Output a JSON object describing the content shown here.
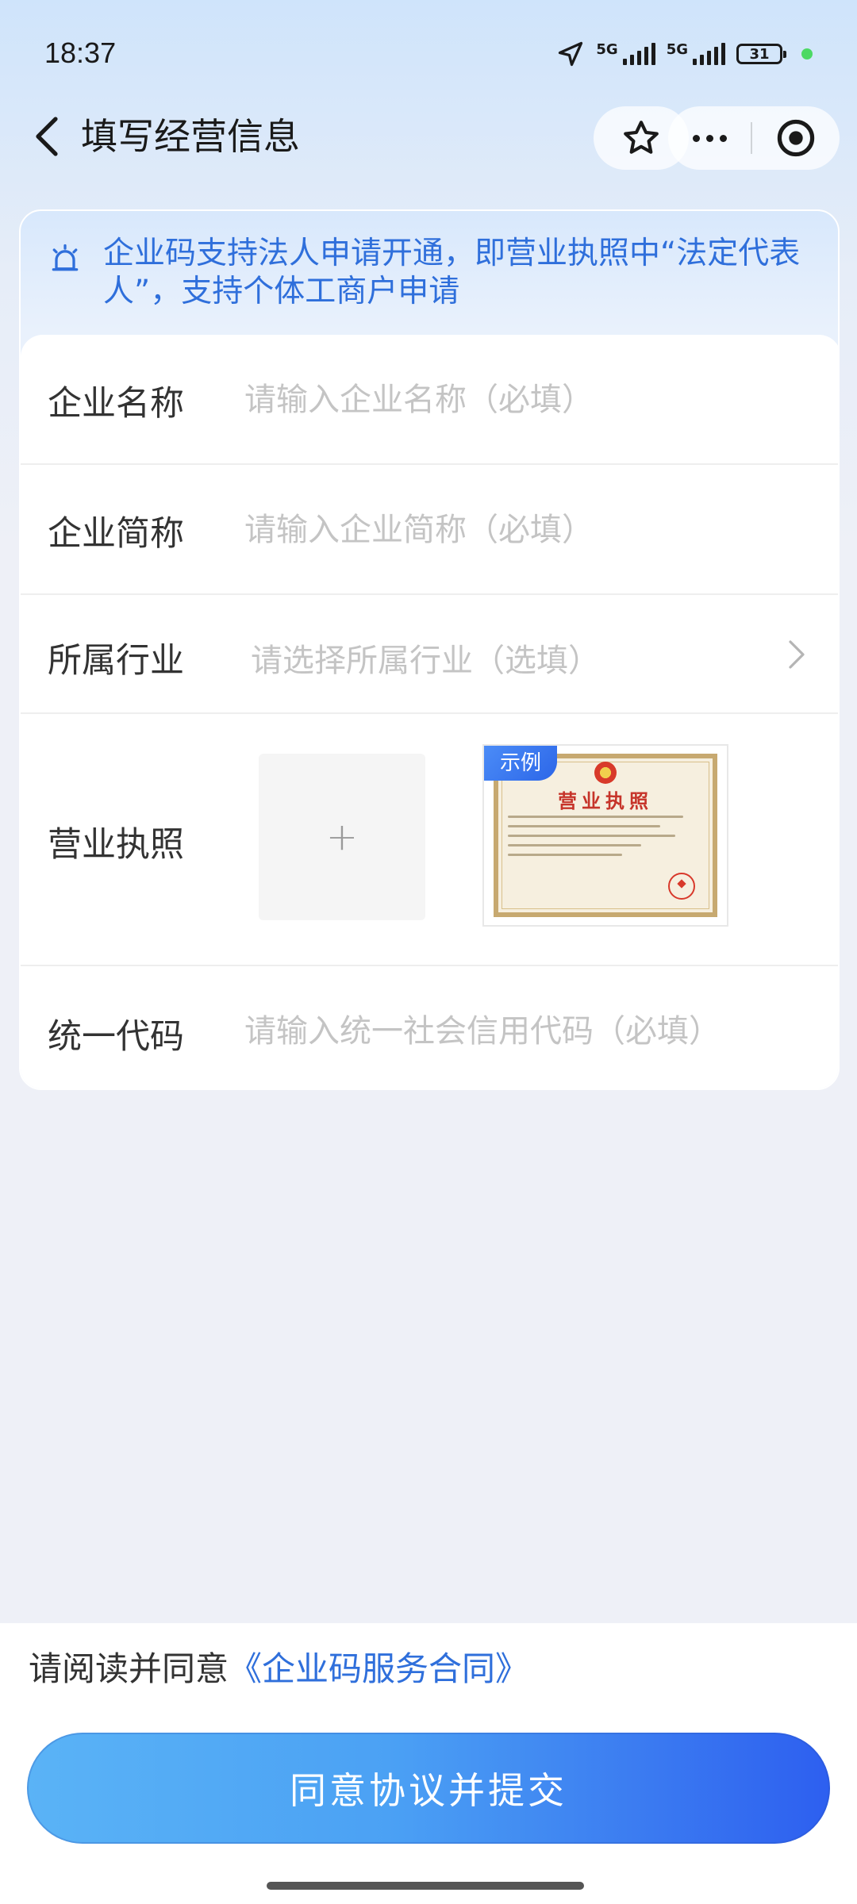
{
  "status_bar": {
    "time": "18:37",
    "network_1": "5G",
    "network_2": "5G",
    "battery": "31"
  },
  "nav": {
    "title": "填写经营信息"
  },
  "notice": {
    "text": "企业码支持法人申请开通，即营业执照中“法定代表人”，支持个体工商户申请"
  },
  "form": {
    "company_name": {
      "label": "企业名称",
      "placeholder": "请输入企业名称（必填）"
    },
    "company_short": {
      "label": "企业简称",
      "placeholder": "请输入企业简称（必填）"
    },
    "industry": {
      "label": "所属行业",
      "placeholder": "请选择所属行业（选填）"
    },
    "license": {
      "label": "营业执照",
      "upload_symbol": "+",
      "sample_badge": "示例",
      "sample_title": "营业执照"
    },
    "credit_code": {
      "label": "统一代码",
      "placeholder": "请输入统一社会信用代码（必填）"
    }
  },
  "footer": {
    "agreement_prefix": "请阅读并同意",
    "agreement_link": "《企业码服务合同》",
    "submit_label": "同意协议并提交"
  },
  "colors": {
    "accent": "#2f6fdb",
    "placeholder": "#c4c4c4",
    "button_start": "#5ab3f6",
    "button_end": "#2d5ff0"
  },
  "icons": {
    "back": "chevron-left-icon",
    "favorite": "star-icon",
    "more": "more-dots-icon",
    "close": "target-close-icon",
    "notice": "alarm-bell-icon",
    "industry_arrow": "chevron-right-icon",
    "upload": "plus-icon"
  }
}
